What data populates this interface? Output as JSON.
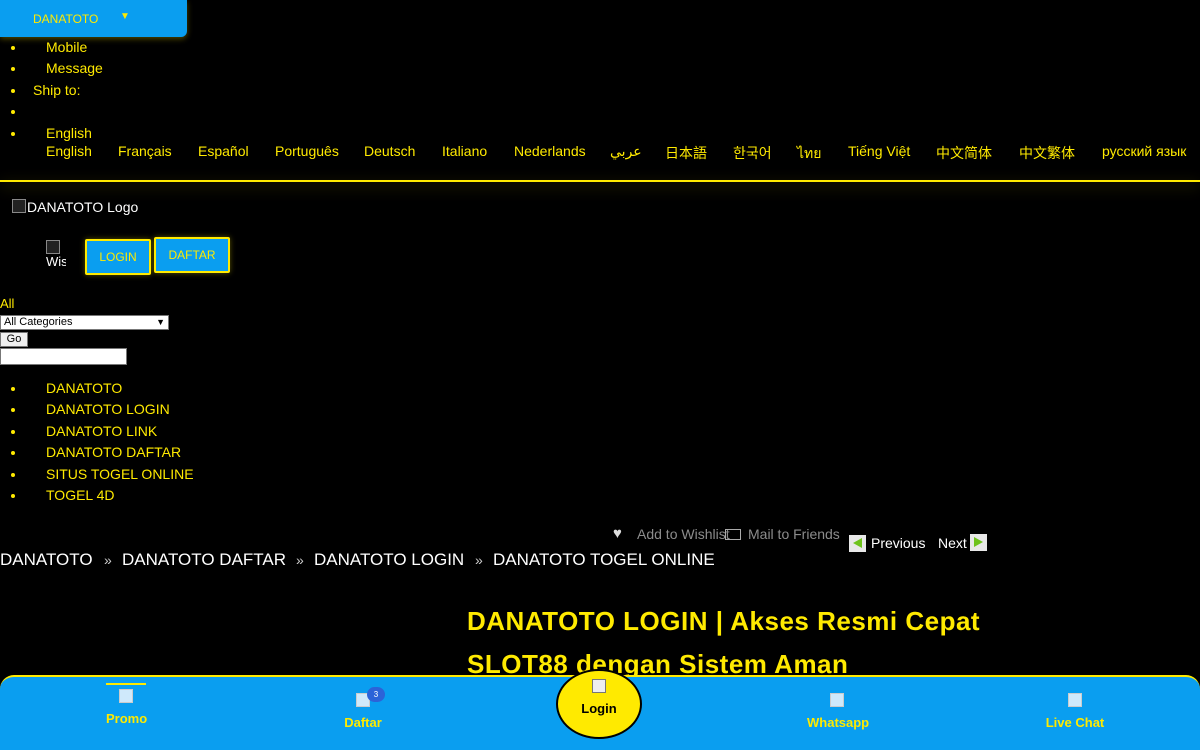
{
  "top_tab": {
    "label": "DANATOTO",
    "caret": "▼"
  },
  "top_links": [
    "Mobile",
    "Message",
    "Ship to:",
    "",
    "English"
  ],
  "languages": [
    "English",
    "Français",
    "Español",
    "Português",
    "Deutsch",
    "Italiano",
    "Nederlands",
    "عربي",
    "日本語",
    "한국어",
    "ไทย",
    "Tiếng Việt",
    "中文简体",
    "中文繁体",
    "русский язык"
  ],
  "header": {
    "logo_alt": "DANATOTO Logo",
    "wish_alt": "Wis",
    "login_label": "LOGIN",
    "daftar_label": "DAFTAR"
  },
  "search": {
    "label": "All",
    "select_value": "All Categories",
    "go_label": "Go",
    "input_value": ""
  },
  "categories": [
    "DANATOTO",
    "DANATOTO LOGIN",
    "DANATOTO LINK",
    "DANATOTO DAFTAR",
    "SITUS TOGEL ONLINE",
    "TOGEL 4D"
  ],
  "product_actions": {
    "wishlist": "Add to Wishlist",
    "mail": "Mail to Friends",
    "previous": "Previous",
    "next": "Next"
  },
  "breadcrumbs": [
    "DANATOTO",
    "DANATOTO DAFTAR",
    "DANATOTO LOGIN",
    "DANATOTO TOGEL ONLINE"
  ],
  "breadcrumb_separator": "»",
  "headline": "DANATOTO LOGIN | Akses Resmi Cepat SLOT88 dengan Sistem Aman",
  "bottom_nav": {
    "promo": "Promo",
    "daftar": "Daftar",
    "daftar_badge": "3",
    "login": "Login",
    "whatsapp": "Whatsapp",
    "live_chat": "Live Chat"
  },
  "colors": {
    "background": "#000000",
    "accent_yellow": "#ffea00",
    "accent_blue": "#0a9ef0"
  }
}
